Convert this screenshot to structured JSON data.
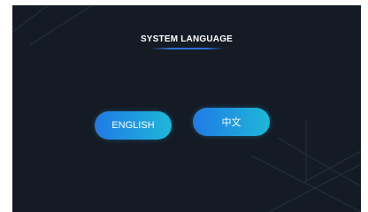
{
  "screen": {
    "title": "SYSTEM LANGUAGE"
  },
  "languages": [
    {
      "label": "ENGLISH"
    },
    {
      "label": "中文"
    }
  ],
  "colors": {
    "background": "#151b24",
    "accent_start": "#1f7be6",
    "accent_end": "#1fb7d8",
    "underline": "#2f6fd6"
  }
}
